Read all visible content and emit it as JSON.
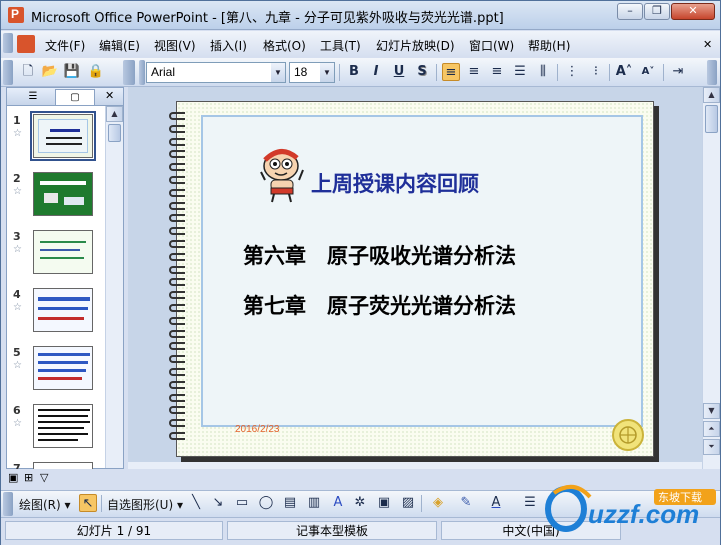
{
  "window": {
    "title": "Microsoft Office PowerPoint - [第八、九章 - 分子可见紫外吸收与荧光光谱.ppt]",
    "minimize_label": "–",
    "restore_label": "❐",
    "close_label": "✕"
  },
  "menu": {
    "items": [
      {
        "label": "文件(F)"
      },
      {
        "label": "编辑(E)"
      },
      {
        "label": "视图(V)"
      },
      {
        "label": "插入(I)"
      },
      {
        "label": "格式(O)"
      },
      {
        "label": "工具(T)"
      },
      {
        "label": "幻灯片放映(D)"
      },
      {
        "label": "窗口(W)"
      },
      {
        "label": "帮助(H)"
      }
    ]
  },
  "toolbar": {
    "font_name": "Arial",
    "font_size": "18",
    "bold_label": "B",
    "italic_label": "I",
    "underline_label": "U",
    "shadow_label": "S"
  },
  "slides_pane": {
    "thumbnails": [
      {
        "num": "1"
      },
      {
        "num": "2"
      },
      {
        "num": "3"
      },
      {
        "num": "4"
      },
      {
        "num": "5"
      },
      {
        "num": "6"
      },
      {
        "num": "7"
      }
    ]
  },
  "slide": {
    "title": "上周授课内容回顾",
    "lines": [
      "第六章　原子吸收光谱分析法",
      "第七章　原子荧光光谱分析法"
    ],
    "date": "2016/2/23"
  },
  "drawing_toolbar": {
    "draw_label": "绘图(R) ▾",
    "autoshape_label": "自选图形(U) ▾"
  },
  "status": {
    "slide_position": "幻灯片 1 / 91",
    "template": "记事本型模板",
    "language": "中文(中国)"
  },
  "watermark": {
    "text": "uzzf.com",
    "subtext": "东坡下载"
  },
  "colors": {
    "title_blue": "#1f2f99",
    "date_orange": "#e3622b",
    "accent_blue": "#31528e"
  }
}
